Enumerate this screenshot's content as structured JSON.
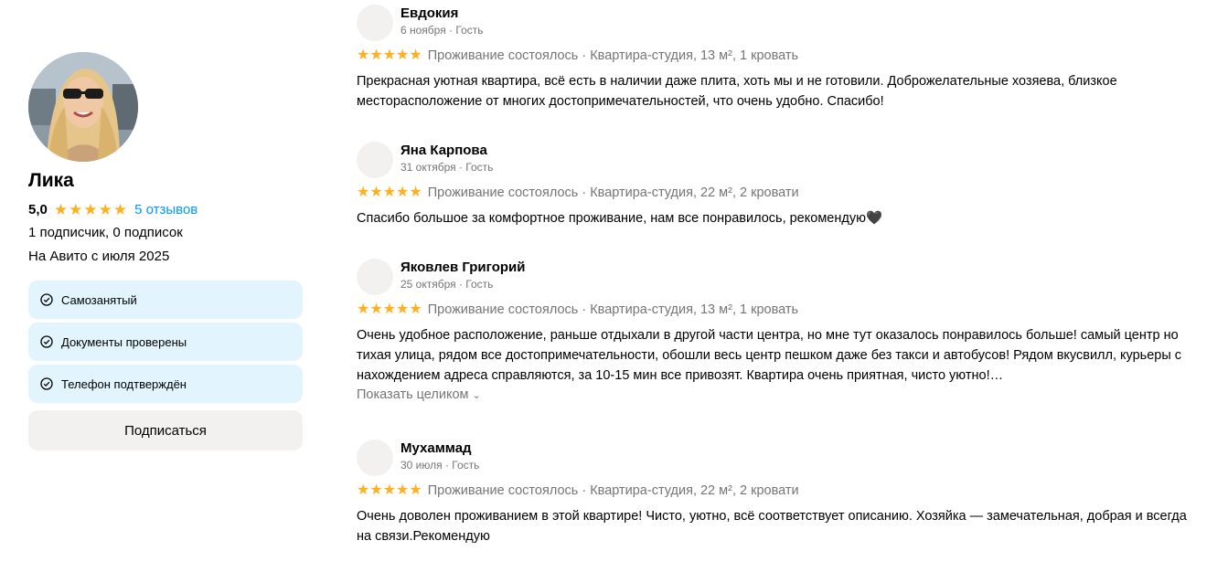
{
  "profile": {
    "name": "Лика",
    "rating": "5,0",
    "reviews_link": "5 отзывов",
    "followers": "1 подписчик, 0 подписок",
    "since": "На Авито с июля 2025",
    "badges": [
      {
        "label": "Самозанятый",
        "icon": "check-circle-icon"
      },
      {
        "label": "Документы проверены",
        "icon": "check-circle-icon"
      },
      {
        "label": "Телефон подтверждён",
        "icon": "check-circle-icon"
      }
    ],
    "subscribe_label": "Подписаться"
  },
  "colors": {
    "star": "#ffb021",
    "link": "#0099f7",
    "badge_bg": "#e2f4fd",
    "button_bg": "#f2f1f0",
    "muted_text": "#757575"
  },
  "reviews": [
    {
      "author": "Евдокия",
      "date": "6 ноября · Гость",
      "rating": 5,
      "info": "Проживание состоялось · Квартира-студия, 13 м², 1 кровать",
      "text": "Прекрасная уютная квартира, всё есть в наличии даже плита, хоть мы и не готовили. Доброжелательные хозяева, близкое месторасположение от многих достопримечательностей, что очень удобно. Спасибо!"
    },
    {
      "author": "Яна Карпова",
      "date": "31 октября · Гость",
      "rating": 5,
      "info": "Проживание состоялось · Квартира-студия, 22 м², 2 кровати",
      "text": "Спасибо большое за комфортное проживание, нам все понравилось, рекомендую🖤"
    },
    {
      "author": "Яковлев Григорий",
      "date": "25 октября · Гость",
      "rating": 5,
      "info": "Проживание состоялось · Квартира-студия, 13 м², 1 кровать",
      "text": "Очень удобное расположение, раньше отдыхали в другой части центра, но мне тут оказалось понравилось больше! самый центр но тихая улица, рядом все достопримечательности, обошли весь центр пешком даже без такси и автобусов! Рядом вкусвилл, курьеры с нахождением адреса справляются, за 10-15 мин все привозят. Квартира очень приятная, чисто уютно!…",
      "show_all": "Показать целиком"
    },
    {
      "author": "Мухаммад",
      "date": "30 июля · Гость",
      "rating": 5,
      "info": "Проживание состоялось · Квартира-студия, 22 м², 2 кровати",
      "text": "Очень доволен проживанием в этой квартире! Чисто, уютно, всё соответствует описанию. Хозяйка — замечательная, добрая и всегда на связи.Рекомендую"
    }
  ]
}
